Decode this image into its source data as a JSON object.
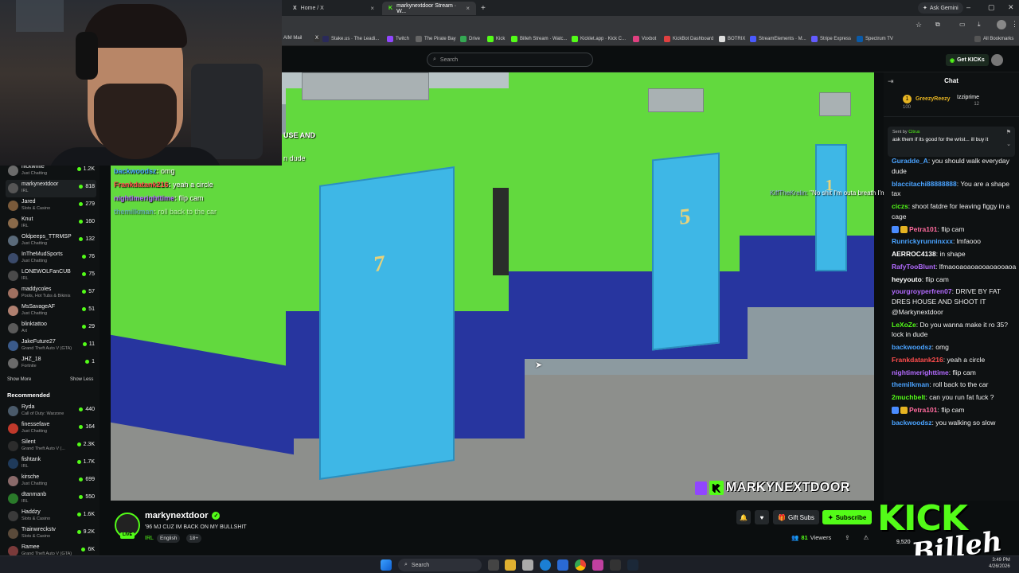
{
  "browser": {
    "tabs": [
      {
        "label": "Home / X",
        "active": false
      },
      {
        "label": "markynextdoor Stream · W...",
        "active": true
      }
    ],
    "ask_gemini": "Ask Gemini",
    "bookmarks": [
      "AIM Mail",
      "Stake.us · The Leadi...",
      "Twitch",
      "The Pirate Bay",
      "Drive",
      "Kick",
      "Billeh Stream · Watc...",
      "Kicklet.app · Kick C...",
      "Voxbot",
      "KickBot Dashboard",
      "BOTRIX",
      "StreamElements · M...",
      "Stripe Express",
      "Spectrum TV"
    ],
    "all_bookmarks": "All Bookmarks"
  },
  "topnav": {
    "search_placeholder": "Search",
    "get_kicks": "Get KICKs"
  },
  "sidebar": {
    "following": [
      {
        "name": "nickwhite",
        "category": "Just Chatting",
        "viewers": "1.2K",
        "color": "#6b6b6b"
      },
      {
        "name": "markynextdoor",
        "category": "IRL",
        "viewers": "818",
        "color": "#555555",
        "active": true
      },
      {
        "name": "Jared",
        "category": "Slots & Casino",
        "viewers": "279",
        "color": "#7a5a3a"
      },
      {
        "name": "Knut",
        "category": "IRL",
        "viewers": "160",
        "color": "#8a6a4a"
      },
      {
        "name": "Oldpeeps_TTRMSP",
        "category": "Just Chatting",
        "viewers": "132",
        "color": "#5a6a7a"
      },
      {
        "name": "InTheMudSports",
        "category": "Just Chatting",
        "viewers": "76",
        "color": "#3a4a6a"
      },
      {
        "name": "LONEWOLFanCUB",
        "category": "IRL",
        "viewers": "75",
        "color": "#4a4a4a"
      },
      {
        "name": "maddycoles",
        "category": "Pools, Hot Tubs & Bikinis",
        "viewers": "57",
        "color": "#a07060"
      },
      {
        "name": "MsSavageAF",
        "category": "Just Chatting",
        "viewers": "51",
        "color": "#b08070"
      },
      {
        "name": "blinktattoo",
        "category": "Art",
        "viewers": "29",
        "color": "#5a5a5a"
      },
      {
        "name": "JakeFuture27",
        "category": "Grand Theft Auto V (GTA)",
        "viewers": "11",
        "color": "#3a5a8a"
      },
      {
        "name": "JHZ_18",
        "category": "Fortnite",
        "viewers": "1",
        "color": "#6a6a6a"
      }
    ],
    "show_more": "Show More",
    "show_less": "Show Less",
    "recommended_heading": "Recommended",
    "recommended": [
      {
        "name": "Ryda",
        "category": "Call of Duty: Warzone",
        "viewers": "440",
        "color": "#4a5a6a"
      },
      {
        "name": "finessefave",
        "category": "Just Chatting",
        "viewers": "164",
        "color": "#c0392b"
      },
      {
        "name": "Silent",
        "category": "Grand Theft Auto V (...",
        "viewers": "2.3K",
        "color": "#2c2c2c"
      },
      {
        "name": "fishtank",
        "category": "IRL",
        "viewers": "1.7K",
        "color": "#1f3a5a"
      },
      {
        "name": "kirsche",
        "category": "Just Chatting",
        "viewers": "699",
        "color": "#8a6a6a"
      },
      {
        "name": "dtanmanb",
        "category": "IRL",
        "viewers": "550",
        "color": "#2a7a2a"
      },
      {
        "name": "Haddzy",
        "category": "Slots & Casino",
        "viewers": "1.6K",
        "color": "#3a3a3a"
      },
      {
        "name": "Trainwreckstv",
        "category": "Slots & Casino",
        "viewers": "9.2K",
        "color": "#5a4a3a"
      },
      {
        "name": "Ramee",
        "category": "Grand Theft Auto V (GTA)",
        "viewers": "6K",
        "color": "#7a3a3a"
      }
    ]
  },
  "video": {
    "overlay_chat": [
      {
        "user": "backwoodsz",
        "text": "omg",
        "color": "#4aa3ff"
      },
      {
        "user": "Frankdatank216",
        "text": "yeah a circle",
        "color": "#ff4d4d"
      },
      {
        "user": "nightimerighttime",
        "text": "flip cam",
        "color": "#b36bff"
      },
      {
        "user": "themilkman",
        "text": "roll back to the car",
        "color": "#6b8cff"
      }
    ],
    "overlay_fragments": [
      "USE AND",
      "n dude"
    ],
    "kiff_user": "KiffTheKrelin:",
    "kiff_text": "\"No shit I'm outa breath I'm fat bro\"",
    "door_numbers": [
      "7",
      "5",
      "1"
    ],
    "watermark": "MARKYNEXTDOOR"
  },
  "stream": {
    "channel": "markynextdoor",
    "live": "LIVE",
    "title": "'96 MJ CUZ IM BACK ON MY BULLSHIT",
    "category": "IRL",
    "tags": [
      "English",
      "18+"
    ],
    "gift_subs": "Gift Subs",
    "subscribe": "Subscribe",
    "viewer_count": "81",
    "viewers_label": "Viewers"
  },
  "chat": {
    "header": "Chat",
    "gifters": [
      {
        "name": "GreezyReezy",
        "count": "100"
      },
      {
        "name": "Izziprime",
        "count": "12"
      }
    ],
    "pinned_meta": "Sent by",
    "pinned_user": "Citrus",
    "pinned_text": "ask them if its good for the wrist... ill buy it",
    "messages": [
      {
        "user": "Guradde_A",
        "text": "you should walk everyday dude",
        "color": "#4aa3ff"
      },
      {
        "user": "blaccitachi88888888",
        "text": "You are a shape tax",
        "color": "#4aa3ff"
      },
      {
        "user": "ciczs",
        "text": "shoot fatdre for leaving figgy in a cage",
        "color": "#53fc18"
      },
      {
        "user": "Petra101",
        "text": "flip cam",
        "color": "#ff6b9e",
        "badges": true
      },
      {
        "user": "Runrickyrunninxxx",
        "text": "lmfaooo",
        "color": "#4aa3ff"
      },
      {
        "user": "AERROC4138",
        "text": "in shape",
        "color": "#ffffff"
      },
      {
        "user": "RafyTooBlunt",
        "text": "lfmaooaoaoaooaoaooaoa",
        "color": "#b36bff"
      },
      {
        "user": "heyyouto",
        "text": "flip cam",
        "color": "#ffffff"
      },
      {
        "user": "yourgroyperfren07",
        "text": "DRIVE BY FAT DRES HOUSE AND SHOOT IT @Markynextdoor",
        "color": "#b36bff"
      },
      {
        "user": "LeXoZe",
        "text": "Do you wanna make it ro 35? lock in dude",
        "color": "#53fc18"
      },
      {
        "user": "backwoodsz",
        "text": "omg",
        "color": "#4aa3ff"
      },
      {
        "user": "Frankdatank216",
        "text": "yeah a circle",
        "color": "#ff4d4d"
      },
      {
        "user": "nightimerighttime",
        "text": "flip cam",
        "color": "#b36bff"
      },
      {
        "user": "themilkman",
        "text": "roll back to the car",
        "color": "#4aa3ff"
      },
      {
        "user": "2muchbelt",
        "text": "can you run fat fuck ?",
        "color": "#53fc18"
      },
      {
        "user": "Petra101",
        "text": "flip cam",
        "color": "#ff6b9e",
        "badges": true
      },
      {
        "user": "backwoodsz",
        "text": "you walking so slow",
        "color": "#4aa3ff"
      }
    ]
  },
  "logo": {
    "big": "KICK",
    "signature": "Billeh",
    "count": "9,520"
  },
  "taskbar": {
    "search": "Search",
    "time": "3:49 PM",
    "date": "4/26/2026"
  }
}
